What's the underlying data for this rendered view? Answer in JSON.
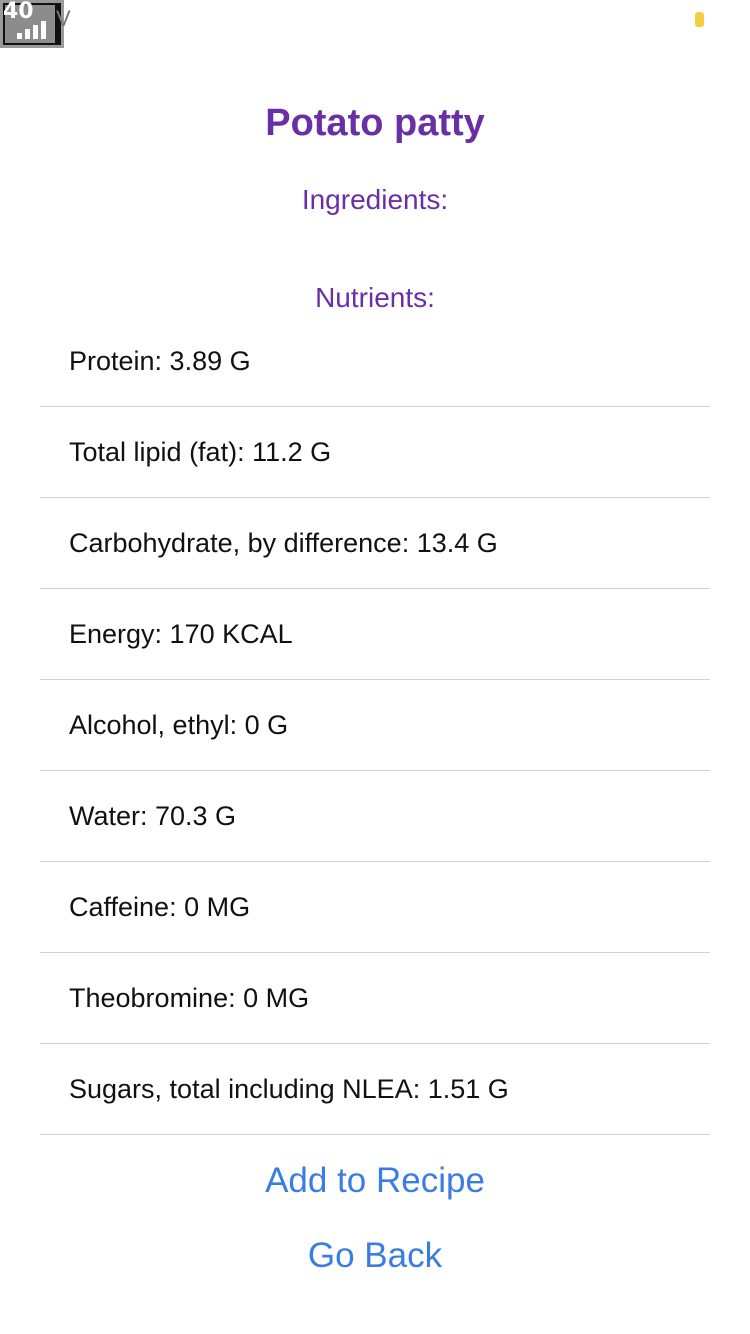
{
  "status_bar": {
    "signal_text": "40",
    "carrier": "V",
    "battery_color": "#f4d03f"
  },
  "page": {
    "title": "Potato patty",
    "ingredients_label": "Ingredients:",
    "nutrients_label": "Nutrients:"
  },
  "nutrients": [
    "Protein: 3.89 G",
    "Total lipid (fat): 11.2 G",
    "Carbohydrate, by difference: 13.4 G",
    "Energy: 170 KCAL",
    "Alcohol, ethyl: 0 G",
    "Water: 70.3 G",
    "Caffeine: 0 MG",
    "Theobromine: 0 MG",
    "Sugars, total including NLEA: 1.51 G"
  ],
  "actions": {
    "add_label": "Add to Recipe",
    "back_label": "Go Back"
  },
  "colors": {
    "title": "#6a2fa6",
    "link": "#3a7de0"
  }
}
